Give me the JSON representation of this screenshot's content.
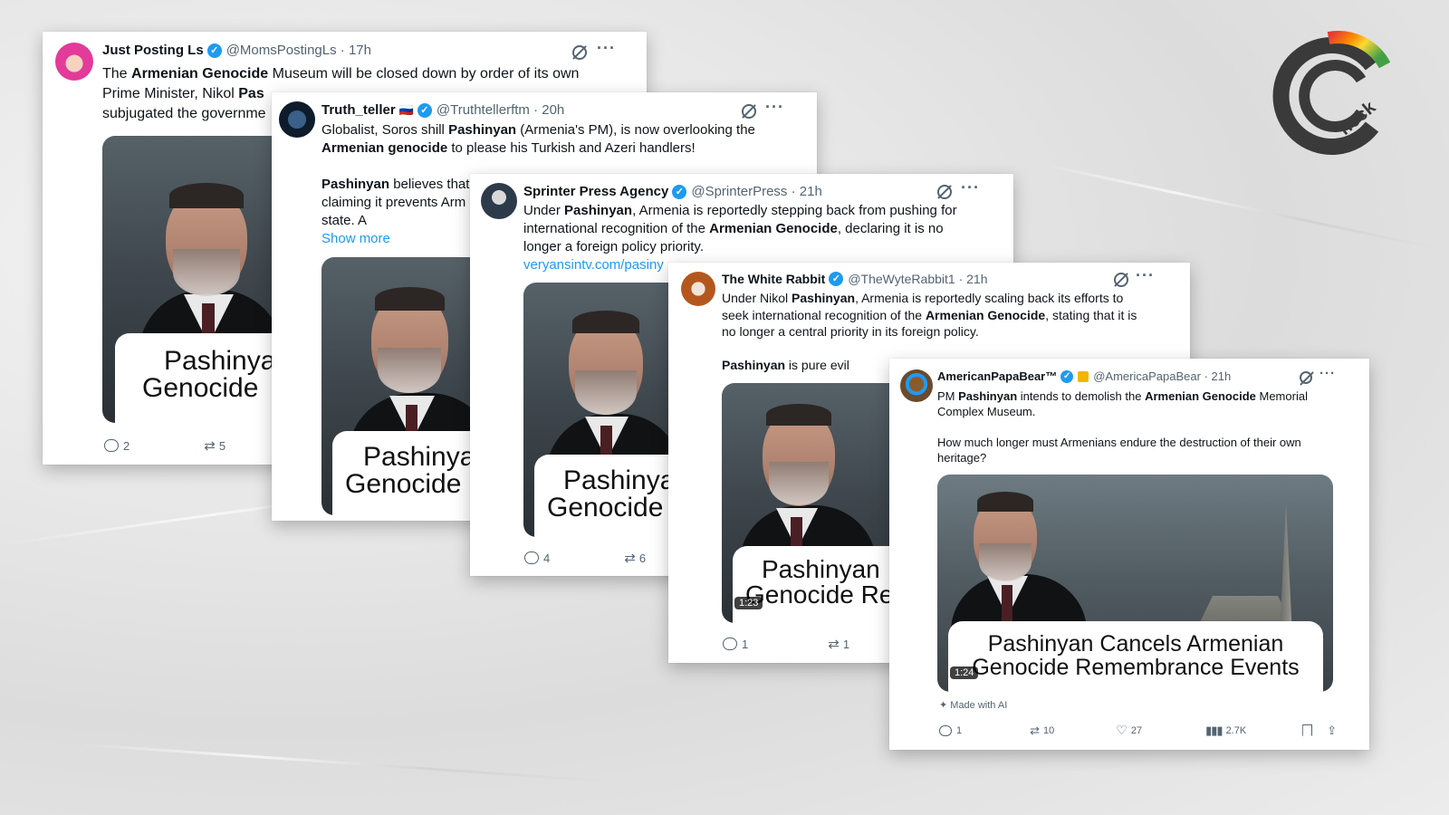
{
  "posts": [
    {
      "name": "Just Posting Ls",
      "handle": "@MomsPostingLs · 17h",
      "t1": "The ",
      "b1": "Armenian Genocide",
      "t2": " Museum will be closed down by order of its own",
      "line2": "Prime Minister, Nikol ",
      "b2": "Pas",
      "line3": "subjugated the governme",
      "caption1": "Pashinya",
      "caption2": "Genocide",
      "replies": "2",
      "reposts": "5"
    },
    {
      "name": "Truth_teller",
      "flag": "🇷🇺",
      "handle": "@Truthtellerftm · 20h",
      "t1": "Globalist, Soros shill ",
      "b1": "Pashinyan",
      "t2": " (Armenia's PM), is now overlooking the",
      "b2": "Armenian genocide",
      "t3": " to please his Turkish and Azeri handlers!",
      "b3": "Pashinyan",
      "t4": " believes that",
      "line4": "claiming it prevents Arm",
      "line5": "state. A",
      "show_more": "Show more",
      "caption1": "Pashinya",
      "caption2": "Genocide"
    },
    {
      "name": "Sprinter Press Agency",
      "handle": "@SprinterPress · 21h",
      "t1": "Under ",
      "b1": "Pashinyan",
      "t2": ", Armenia is reportedly stepping back from pushing for",
      "t3": "international recognition of the ",
      "b2": "Armenian Genocide",
      "t4": ", declaring it is no",
      "t5": "longer a foreign policy priority.",
      "link": "veryansintv.com/pasiny",
      "caption1": "Pashinya",
      "caption2": "Genocide",
      "replies": "4",
      "reposts": "6"
    },
    {
      "name": "The White Rabbit",
      "handle": "@TheWyteRabbit1 · 21h",
      "t1": "Under Nikol ",
      "b1": "Pashinyan",
      "t2": ", Armenia is reportedly scaling back its efforts to",
      "t3": "seek international recognition of the ",
      "b2": "Armenian Genocide",
      "t4": ", stating that it is",
      "t5": "no longer a central priority in its foreign policy.",
      "b3": "Pashinyan",
      "t6": " is pure evil",
      "caption1": "Pashinyan",
      "caption2": "Genocide Re",
      "duration": "1:23",
      "replies": "1",
      "reposts": "1"
    },
    {
      "name": "AmericanPapaBear™",
      "handle": "@AmericaPapaBear · 21h",
      "t1": "PM ",
      "b1": "Pashinyan",
      "t2": " intends to demolish the ",
      "b2": "Armenian Genocide",
      "t3": " Memorial",
      "t4": "Complex Museum.",
      "t5": "How much longer must Armenians endure the destruction of their own",
      "t6": "heritage?",
      "caption1": "Pashinyan Cancels Armenian",
      "caption2": "Genocide Remembrance Events",
      "duration": "1:24",
      "made_with_ai": "Made with AI",
      "replies": "1",
      "reposts": "10",
      "likes": "27",
      "views": "2.7K"
    }
  ],
  "logo": {
    "text": "heck"
  }
}
